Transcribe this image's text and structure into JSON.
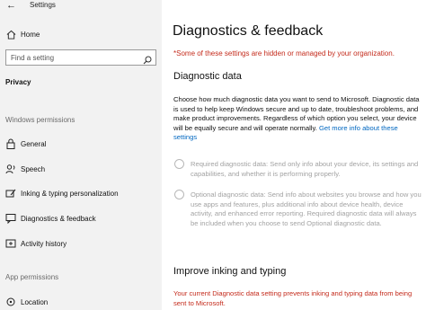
{
  "window": {
    "title": "Settings",
    "back_glyph": "←"
  },
  "sidebar": {
    "home_label": "Home",
    "search_placeholder": "Find a setting",
    "section": "Privacy",
    "group_windows": "Windows permissions",
    "items": [
      {
        "label": "General",
        "icon": "lock-icon"
      },
      {
        "label": "Speech",
        "icon": "speech-icon"
      },
      {
        "label": "Inking & typing personalization",
        "icon": "pen-icon"
      },
      {
        "label": "Diagnostics & feedback",
        "icon": "feedback-icon"
      },
      {
        "label": "Activity history",
        "icon": "history-icon"
      }
    ],
    "group_app": "App permissions",
    "app_items": [
      {
        "label": "Location",
        "icon": "location-icon"
      }
    ]
  },
  "main": {
    "title": "Diagnostics & feedback",
    "managed_notice": "*Some of these settings are hidden or managed by your organization.",
    "diagnostic": {
      "heading": "Diagnostic data",
      "description": "Choose how much diagnostic data you want to send to Microsoft. Diagnostic data is used to help keep Windows secure and up to date, troubleshoot problems, and make product improvements. Regardless of which option you select, your device will be equally secure and will operate normally.",
      "link": "Get more info about these settings",
      "options": [
        {
          "text": "Required diagnostic data: Send only info about your device, its settings and capabilities, and whether it is performing properly.",
          "selected": false
        },
        {
          "text": "Optional diagnostic data: Send info about websites you browse and how you use apps and features, plus additional info about device health, device activity, and enhanced error reporting. Required diagnostic data will always be included when you choose to send Optional diagnostic data.",
          "selected": false
        }
      ]
    },
    "inking": {
      "heading": "Improve inking and typing",
      "warning": "Your current Diagnostic data setting prevents inking and typing data from being sent to Microsoft."
    }
  }
}
